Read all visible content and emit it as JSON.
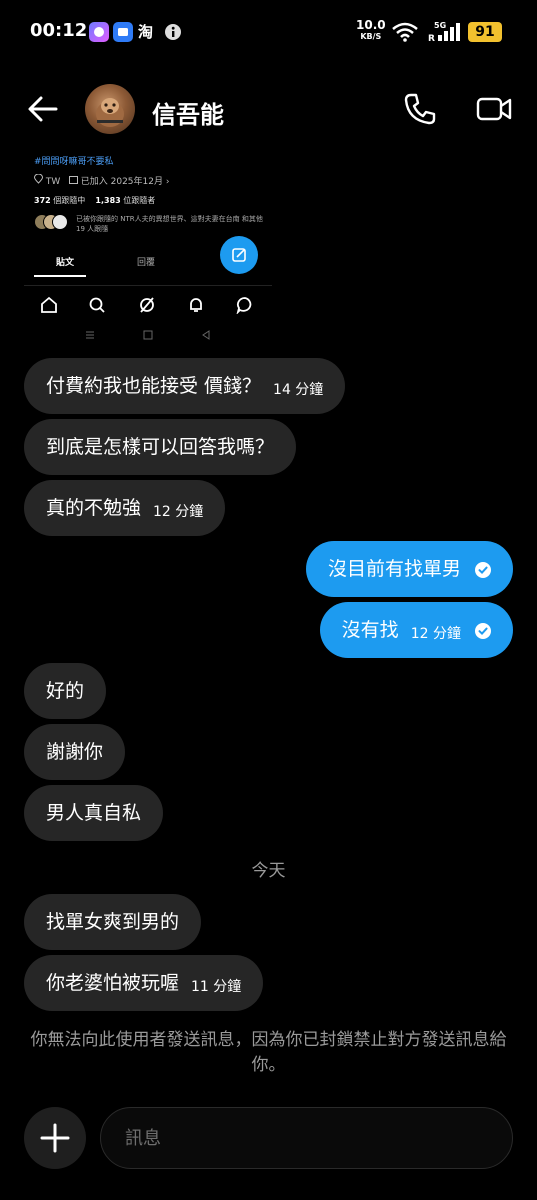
{
  "status_bar": {
    "time": "00:12",
    "app_icons": [
      "notification-app-icon",
      "files-app-icon",
      "taobao-app-icon",
      "info-icon"
    ],
    "taobao_glyph": "淘",
    "net_speed_value": "10.0",
    "net_speed_unit": "KB/S",
    "net_type": "5G",
    "battery": "91",
    "colors": {
      "battery": "#f2c12e"
    }
  },
  "header": {
    "contact_name": "信吾能",
    "icons": [
      "back-arrow-icon",
      "phone-icon",
      "video-icon"
    ]
  },
  "shared_image": {
    "hashtag": "#問問呀嘛哥不要私",
    "location": "TW",
    "joined": "已加入 2025年12月",
    "following_count": "372",
    "following_label": "個跟隨中",
    "followers_count": "1,383",
    "followers_label": "位跟隨者",
    "followed_by": "已被你跟隨的 NTR人夫的異想世界、這對夫妻在台南 和其他 19 人跟隨",
    "tabs": [
      "貼文",
      "回覆"
    ],
    "colors": {
      "link": "#4b9df4",
      "fab": "#1d9bf0"
    }
  },
  "messages": [
    {
      "side": "in",
      "text": "付費約我也能接受 價錢？",
      "time": "14 分鐘"
    },
    {
      "side": "in",
      "text": "到底是怎樣可以回答我嗎？",
      "time": ""
    },
    {
      "side": "in",
      "text": "真的不勉強",
      "time": "12 分鐘"
    },
    {
      "side": "out",
      "text": "沒目前有找單男",
      "time": ""
    },
    {
      "side": "out",
      "text": "沒有找",
      "time": "12 分鐘"
    },
    {
      "side": "in",
      "text": "好的",
      "time": ""
    },
    {
      "side": "in",
      "text": "謝謝你",
      "time": ""
    },
    {
      "side": "in",
      "text": "男人真自私",
      "time": ""
    },
    {
      "side": "in",
      "text": "找單女爽到男的",
      "time": ""
    },
    {
      "side": "in",
      "text": "你老婆怕被玩喔",
      "time": "11 分鐘"
    }
  ],
  "date_separator": "今天",
  "notice": "你無法向此使用者發送訊息，因為你已封鎖禁止對方發送訊息給你。",
  "composer": {
    "placeholder": "訊息"
  },
  "colors": {
    "background": "#000000",
    "incoming_bubble": "#262626",
    "outgoing_bubble": "#1d9bf0",
    "muted_text": "#9a9a9a"
  }
}
